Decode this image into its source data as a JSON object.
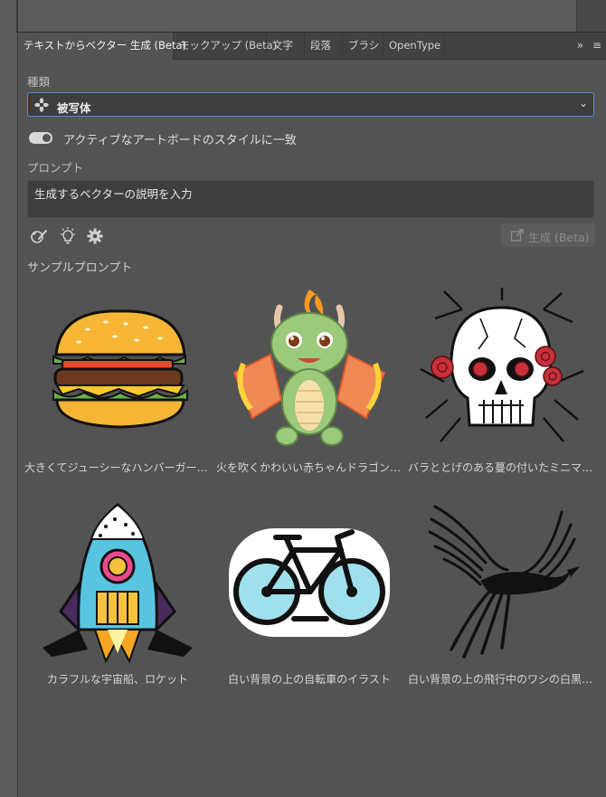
{
  "tabs": [
    {
      "label": "テキストからベクター 生成 (Beta)",
      "active": true
    },
    {
      "label": "モックアップ (Beta)",
      "active": false
    },
    {
      "label": "文字",
      "active": false
    },
    {
      "label": "段落",
      "active": false
    },
    {
      "label": "ブラシ",
      "active": false
    },
    {
      "label": "OpenType",
      "active": false
    }
  ],
  "tab_tools": {
    "overflow": "»",
    "menu": "≡"
  },
  "type_section": {
    "label": "種類",
    "selected": "被写体"
  },
  "style_toggle": {
    "label": "アクティブなアートボードのスタイルに一致",
    "on": true
  },
  "prompt_section": {
    "label": "プロンプト",
    "value": "生成するベクターの説明を入力"
  },
  "generate_button": {
    "label": "生成 (Beta)"
  },
  "samples_section": {
    "label": "サンプルプロンプト",
    "items": [
      {
        "caption": "大きくてジューシーなハンバーガー …",
        "art": "hamburger"
      },
      {
        "caption": "火を吹くかわいい赤ちゃんドラゴン …",
        "art": "dragon"
      },
      {
        "caption": "バラととげのある蔓の付いたミニマ …",
        "art": "skull-roses"
      },
      {
        "caption": "カラフルな宇宙船、ロケット",
        "art": "rocket"
      },
      {
        "caption": "白い背景の上の自転車のイラスト",
        "art": "bicycle"
      },
      {
        "caption": "白い背景の上の飛行中のワシの白黒 …",
        "art": "eagle"
      }
    ]
  },
  "colors": {
    "accent": "#4a90d9",
    "panel": "#535353",
    "tabbar": "#424242"
  }
}
